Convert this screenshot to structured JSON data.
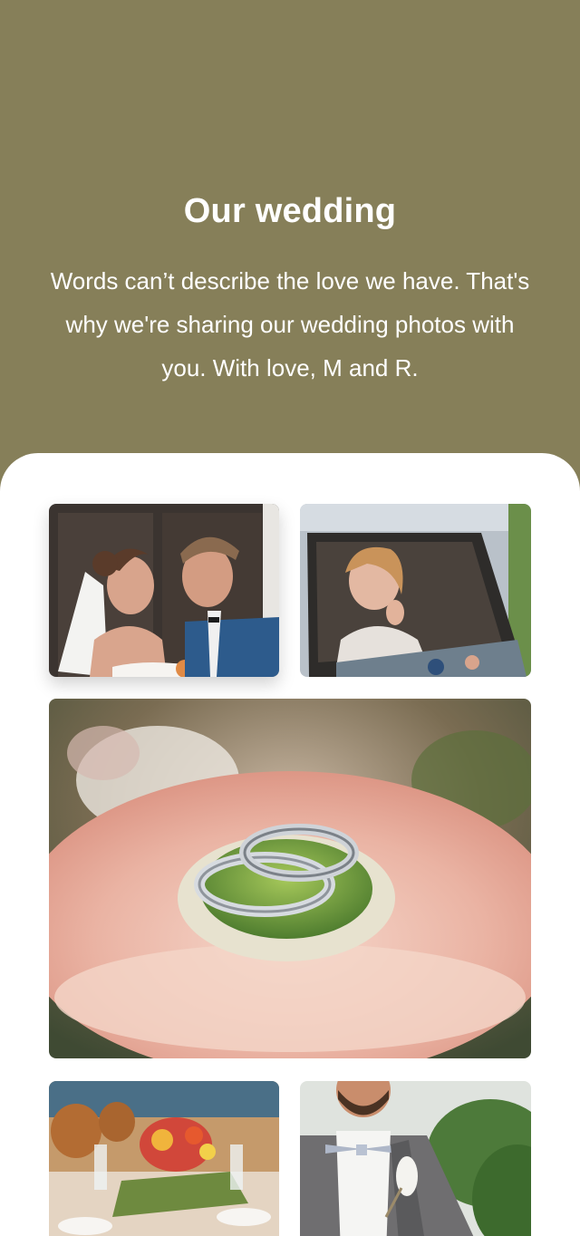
{
  "hero": {
    "title": "Our wedding",
    "text": "Words can’t describe the love we have. That's why we're sharing our wedding photos with you. With love, M and R.",
    "background_color": "#867f59",
    "text_color": "#ffffff"
  },
  "gallery": {
    "background_color": "#ffffff",
    "photos": [
      {
        "name": "couple-portrait-photo"
      },
      {
        "name": "bride-in-car-photo"
      },
      {
        "name": "rings-on-flower-photo"
      },
      {
        "name": "table-setting-photo"
      },
      {
        "name": "groom-boutonniere-photo"
      }
    ]
  }
}
